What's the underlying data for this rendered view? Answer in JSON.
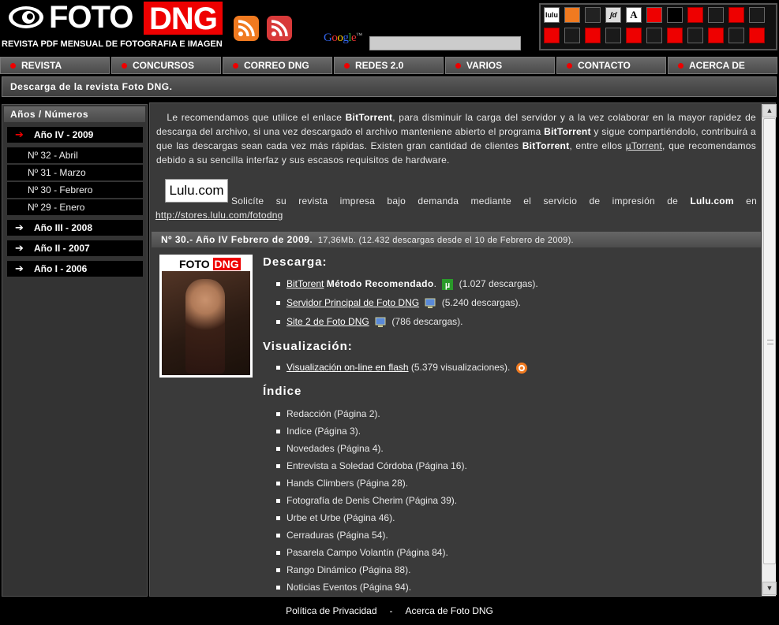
{
  "header": {
    "logo_foto": "FOTO",
    "logo_dng": "DNG",
    "tagline": "REVISTA PDF MENSUAL DE FOTOGRAFIA E IMAGEN",
    "google_label": "Google™",
    "search_value": "",
    "grid_icons": [
      "lulu-icon",
      "flash-icon",
      "foto-icon",
      "signature-icon",
      "a-icon",
      "fotodng-icon",
      "eye-icon"
    ]
  },
  "nav": {
    "items": [
      "REVISTA",
      "CONCURSOS",
      "CORREO DNG",
      "REDES 2.0",
      "VARIOS",
      "CONTACTO",
      "ACERCA DE"
    ]
  },
  "breadcrumb": "Descarga de la revista Foto DNG.",
  "sidebar": {
    "title": "Años / Números",
    "years": [
      {
        "label": "Año IV - 2009"
      },
      {
        "label": "Año III - 2008"
      },
      {
        "label": "Año II - 2007"
      },
      {
        "label": "Año I - 2006"
      }
    ],
    "issues": [
      "Nº 32 - Abril",
      "Nº 31 - Marzo",
      "Nº 30 - Febrero",
      "Nº 29 - Enero"
    ]
  },
  "content": {
    "intro_1": "Le recomendamos que utilice el enlace",
    "bt1": "BitTorrent",
    "intro_2": ", para disminuir la carga del servidor y a la vez colaborar en la mayor rapidez de descarga del archivo, si una vez descargado el archivo manteniene abierto el programa",
    "bt2": "BitTorrent",
    "intro_3": "y sigue compartiéndolo, contribuirá a que las descargas sean cada vez más rápidas. Existen gran cantidad de clientes",
    "bt3": "BitTorrent",
    "intro_4": ", entre ellos",
    "utorrent": "µTorrent",
    "intro_5": ", que recomendamos debido a su sencilla interfaz y sus escasos requisitos de hardware.",
    "lulu_logo": "Lulu.com",
    "lulu_1": "Solicíte su revista impresa bajo demanda mediante el servicio de impresión de",
    "lulu_bold": "Lulu.com",
    "lulu_2": "en",
    "lulu_link": "http://stores.lulu.com/fotodng",
    "issue_title": "Nº 30.- Año IV Febrero de 2009.",
    "issue_meta": "17,36Mb. (12.432 descargas desde el 10 de Febrero de 2009).",
    "cover_title_foto": "FOTO",
    "cover_title_dng": "DNG",
    "descarga_title": "Descarga:",
    "dl_bittorrent_link": "BitTorent",
    "dl_bittorrent_bold": "Método Recomendado",
    "dl_bittorrent_count": "(1.027 descargas).",
    "dl_server_link": "Servidor Principal de Foto DNG",
    "dl_server_count": "(5.240 descargas).",
    "dl_site2_link": "Site 2 de Foto DNG",
    "dl_site2_count": "(786 descargas).",
    "visual_title": "Visualización:",
    "visual_link": "Visualización on-line en flash",
    "visual_count": "(5.379 visualizaciones).",
    "indice_title": "Índice",
    "indice": [
      "Redacción (Página 2).",
      "Indice (Página 3).",
      "Novedades (Página 4).",
      "Entrevista a Soledad Córdoba (Página 16).",
      "Hands Climbers (Página 28).",
      "Fotografía de Denis Cherim (Página 39).",
      "Urbe et Urbe (Página 46).",
      "Cerraduras (Página 54).",
      "Pasarela Campo Volantín (Página 84).",
      "Rango Dinámico (Página 88).",
      "Noticias Eventos (Página 94)."
    ]
  },
  "footer": {
    "privacy": "Política de Privacidad",
    "separator": "-",
    "about": "Acerca de Foto DNG"
  },
  "colors": {
    "accent_red": "#ee0000",
    "background": "#000000",
    "panel": "#3a3a3a"
  }
}
